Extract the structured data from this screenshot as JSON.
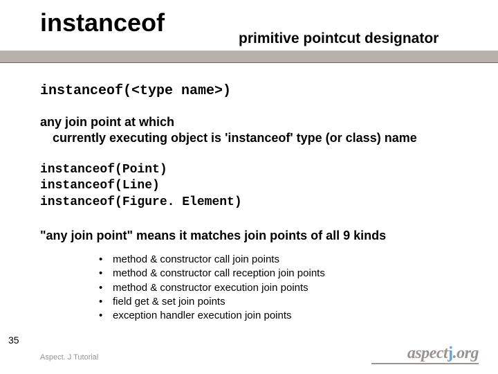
{
  "title": "instanceof",
  "subtitle": "primitive pointcut designator",
  "syntax": "instanceof(<type name>)",
  "desc_line1": "any join point at which",
  "desc_line2": "currently executing object is 'instanceof' type (or class) name",
  "examples": {
    "l1": "instanceof(Point)",
    "l2": "instanceof(Line)",
    "l3": "instanceof(Figure. Element)"
  },
  "desc2": "\"any join point\" means it matches join points of all 9 kinds",
  "bullets": [
    "method & constructor call join points",
    "method & constructor call reception join points",
    "method & constructor execution join points",
    "field get & set join points",
    "exception handler execution join points"
  ],
  "slide_number": "35",
  "footer": "Aspect. J Tutorial",
  "logo": {
    "text_a": "aspect",
    "text_b": ".org",
    "dot": "j"
  }
}
